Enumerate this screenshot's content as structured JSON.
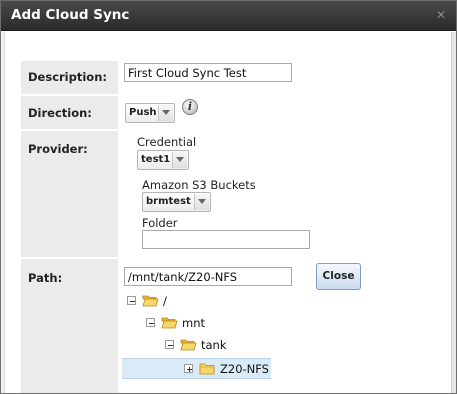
{
  "dialog": {
    "title": "Add Cloud Sync",
    "close_glyph": "✕"
  },
  "form": {
    "description": {
      "label": "Description:",
      "value": "First Cloud Sync Test"
    },
    "direction": {
      "label": "Direction:",
      "selected": "Push",
      "info_icon_glyph": "i"
    },
    "provider": {
      "label": "Provider:",
      "credential_label": "Credential",
      "credential_selected": "test1",
      "buckets_label": "Amazon S3 Buckets",
      "bucket_selected": "brmtest",
      "folder_label": "Folder",
      "folder_value": ""
    },
    "path": {
      "label": "Path:",
      "value": "/mnt/tank/Z20-NFS",
      "close_button_label": "Close",
      "tree": [
        {
          "label": "/",
          "expanded": true
        },
        {
          "label": "mnt",
          "expanded": true
        },
        {
          "label": "tank",
          "expanded": true
        },
        {
          "label": "Z20-NFS",
          "expanded": false,
          "selected": true
        }
      ]
    }
  },
  "colors": {
    "titlebar": "#333333",
    "label_bg": "#ebebeb",
    "selected_row": "#dbeaf7",
    "folder": "#f5c542"
  }
}
